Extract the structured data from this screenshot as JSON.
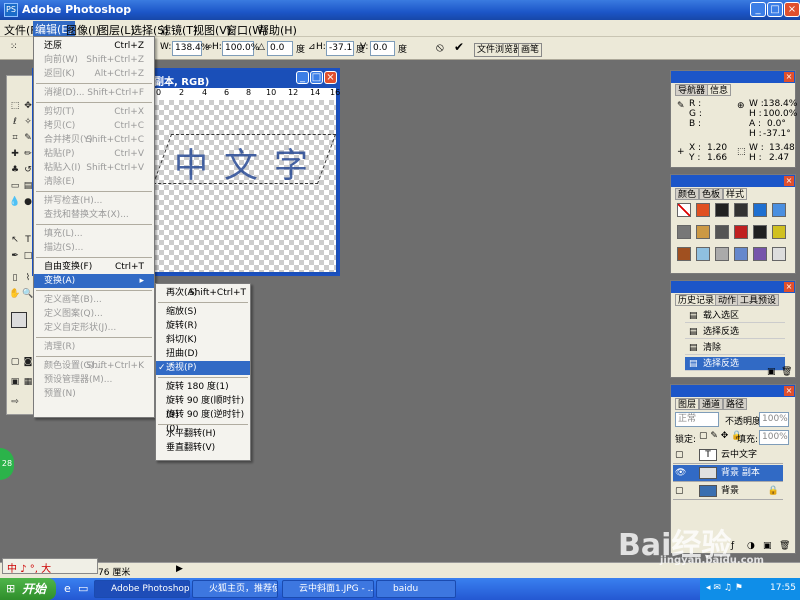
{
  "window": {
    "title": "Adobe Photoshop",
    "app_icon": "PS"
  },
  "menubar": [
    "文件(F)",
    "编辑(E)",
    "图像(I)",
    "图层(L)",
    "选择(S)",
    "滤镜(T)",
    "视图(V)",
    "窗口(W)",
    "帮助(H)"
  ],
  "options": {
    "w_label": "W:",
    "w_value": "138.4%",
    "h_label": "H:",
    "h_value": "100.0%",
    "angle_value": "0.0",
    "angle_unit": "度",
    "skew_h_label": "H:",
    "skew_h_value": "-37.1",
    "skew_unit": "度",
    "v_label": "V:",
    "v_value": "0.0",
    "v_unit": "度",
    "tab_filebrowser": "文件浏览器",
    "tab_brushes": "画笔"
  },
  "document": {
    "title": "副本, RGB)",
    "ruler": [
      "0",
      "2",
      "4",
      "6",
      "8",
      "10",
      "12",
      "14",
      "16"
    ],
    "glyphs": [
      "中",
      "文",
      "字"
    ]
  },
  "edit_menu": [
    {
      "label": "还原",
      "shortcut": "Ctrl+Z",
      "disabled": false
    },
    {
      "label": "向前(W)",
      "shortcut": "Shift+Ctrl+Z",
      "disabled": true
    },
    {
      "label": "返回(K)",
      "shortcut": "Alt+Ctrl+Z",
      "disabled": true
    },
    {
      "label": "消褪(D)...",
      "shortcut": "Shift+Ctrl+F",
      "disabled": true
    },
    {
      "label": "剪切(T)",
      "shortcut": "Ctrl+X",
      "disabled": true
    },
    {
      "label": "拷贝(C)",
      "shortcut": "Ctrl+C",
      "disabled": true
    },
    {
      "label": "合并拷贝(Y)",
      "shortcut": "Shift+Ctrl+C",
      "disabled": true
    },
    {
      "label": "粘贴(P)",
      "shortcut": "Ctrl+V",
      "disabled": true
    },
    {
      "label": "粘贴入(I)",
      "shortcut": "Shift+Ctrl+V",
      "disabled": true
    },
    {
      "label": "清除(E)",
      "shortcut": "",
      "disabled": true
    },
    {
      "label": "拼写检查(H)...",
      "shortcut": "",
      "disabled": true
    },
    {
      "label": "查找和替换文本(X)...",
      "shortcut": "",
      "disabled": true
    },
    {
      "label": "填充(L)...",
      "shortcut": "",
      "disabled": true
    },
    {
      "label": "描边(S)...",
      "shortcut": "",
      "disabled": true
    },
    {
      "label": "自由变换(F)",
      "shortcut": "Ctrl+T",
      "disabled": false
    },
    {
      "label": "变换(A)",
      "shortcut": "",
      "disabled": false,
      "highlight": true
    },
    {
      "label": "定义画笔(B)...",
      "shortcut": "",
      "disabled": true
    },
    {
      "label": "定义图案(Q)...",
      "shortcut": "",
      "disabled": true
    },
    {
      "label": "定义自定形状(J)...",
      "shortcut": "",
      "disabled": true
    },
    {
      "label": "清理(R)",
      "shortcut": "",
      "disabled": true
    },
    {
      "label": "颜色设置(G)...",
      "shortcut": "Shift+Ctrl+K",
      "disabled": true
    },
    {
      "label": "预设管理器(M)...",
      "shortcut": "",
      "disabled": true
    },
    {
      "label": "预置(N)",
      "shortcut": "",
      "disabled": true
    }
  ],
  "transform_menu": [
    {
      "label": "再次(A)",
      "shortcut": "Shift+Ctrl+T"
    },
    {
      "label": "缩放(S)"
    },
    {
      "label": "旋转(R)"
    },
    {
      "label": "斜切(K)"
    },
    {
      "label": "扭曲(D)"
    },
    {
      "label": "透视(P)",
      "checked": true
    },
    {
      "label": "旋转 180 度(1)"
    },
    {
      "label": "旋转 90 度(顺时针)(9)"
    },
    {
      "label": "旋转 90 度(逆时针)(0)"
    },
    {
      "label": "水平翻转(H)"
    },
    {
      "label": "垂直翻转(V)"
    }
  ],
  "info_panel": {
    "tabs": [
      "导航器",
      "信息"
    ],
    "r": "R :",
    "g": "G :",
    "b": "B :",
    "w": "W :",
    "w_val": "138.4%",
    "h": "H :",
    "h_val": "100.0%",
    "a": "A :",
    "a_val": "0.0°",
    "hh": "H :",
    "hh_val": "-37.1°",
    "x": "X :",
    "x_val": "1.20",
    "y": "Y :",
    "y_val": "1.66",
    "w2": "W :",
    "w2_val": "13.48",
    "h2": "H :",
    "h2_val": "2.47"
  },
  "styles_panel": {
    "tabs": [
      "颜色",
      "色板",
      "样式"
    ]
  },
  "history_panel": {
    "tabs": [
      "历史记录",
      "动作",
      "工具预设"
    ],
    "items": [
      {
        "label": "载入选区",
        "selected": false
      },
      {
        "label": "选择反选",
        "selected": false
      },
      {
        "label": "清除",
        "selected": false
      },
      {
        "label": "选择反选",
        "selected": true
      }
    ]
  },
  "layers_panel": {
    "tabs": [
      "图层",
      "通道",
      "路径"
    ],
    "blend_mode": "正常",
    "opacity_label": "不透明度:",
    "opacity": "100%",
    "lock_label": "锁定:",
    "fill_label": "填充:",
    "fill": "100%",
    "layers": [
      {
        "name": "云中文字",
        "selected": false,
        "thumb": "T"
      },
      {
        "name": "背景 副本",
        "selected": true,
        "thumb": ""
      },
      {
        "name": "背景",
        "selected": false,
        "thumb": ""
      }
    ]
  },
  "status": {
    "text": "76 厘米"
  },
  "ime": {
    "text": "中 ♪ °, 大"
  },
  "greenball": {
    "text": "28"
  },
  "taskbar": {
    "start": "开始",
    "tasks": [
      "Adobe Photoshop",
      "火狐主页，推荐使...",
      "云中斜面1.JPG - ...",
      "baidu"
    ],
    "clock": "17:55"
  },
  "watermark": {
    "text": "Bai经验",
    "sub": "jingyan.baidu.com"
  },
  "colors": {
    "accent": "#316ac5",
    "titlebar": "#1c56c8"
  }
}
